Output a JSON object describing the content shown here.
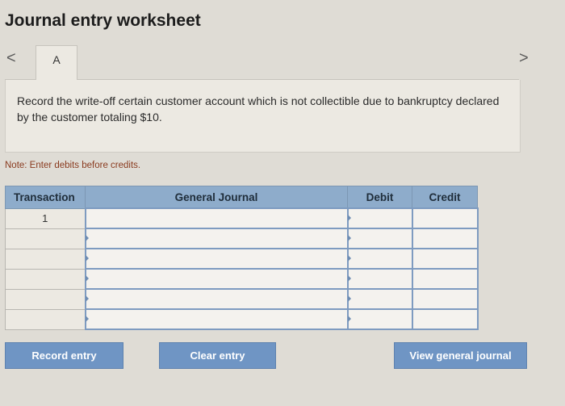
{
  "header": {
    "title": "Journal entry worksheet"
  },
  "navigation": {
    "prev_arrow": "<",
    "next_arrow": ">",
    "tabs": [
      {
        "label": "A"
      }
    ]
  },
  "instruction": {
    "text": "Record the write-off certain customer account which is not collectible due to bankruptcy declared by the customer totaling $10."
  },
  "note": "Note: Enter debits before credits.",
  "journal_table": {
    "headers": {
      "transaction": "Transaction",
      "general_journal": "General Journal",
      "debit": "Debit",
      "credit": "Credit"
    },
    "rows": [
      {
        "transaction": "1",
        "account": "",
        "debit": "",
        "credit": ""
      },
      {
        "transaction": "",
        "account": "",
        "debit": "",
        "credit": ""
      },
      {
        "transaction": "",
        "account": "",
        "debit": "",
        "credit": ""
      },
      {
        "transaction": "",
        "account": "",
        "debit": "",
        "credit": ""
      },
      {
        "transaction": "",
        "account": "",
        "debit": "",
        "credit": ""
      },
      {
        "transaction": "",
        "account": "",
        "debit": "",
        "credit": ""
      }
    ]
  },
  "buttons": {
    "record_entry": "Record entry",
    "clear_entry": "Clear entry",
    "view_general_journal": "View general journal"
  },
  "colors": {
    "header_bg": "#8eaccb",
    "button_bg": "#6f95c4",
    "note_text": "#8a3b1f",
    "page_bg": "#dfdcd5"
  }
}
